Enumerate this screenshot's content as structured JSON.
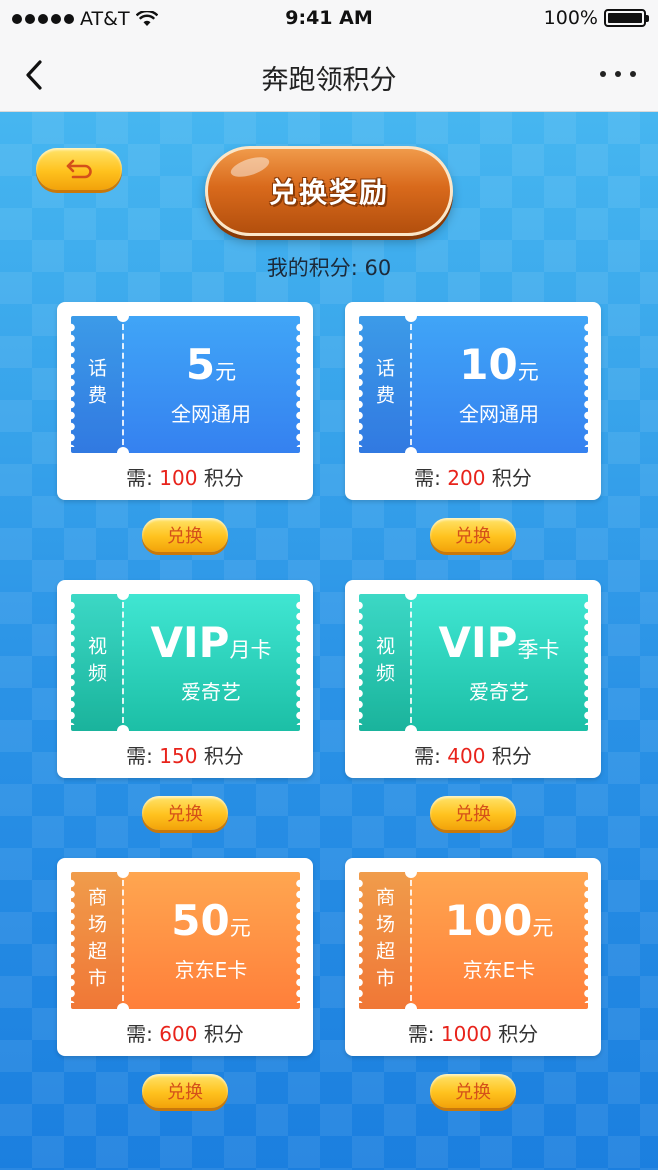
{
  "status_bar": {
    "carrier": "AT&T",
    "time": "9:41 AM",
    "battery": "100%"
  },
  "nav": {
    "title": "奔跑领积分"
  },
  "header": {
    "title_button": "兑换奖励",
    "points_label": "我的积分:",
    "points_value": "60"
  },
  "labels": {
    "need": "需:",
    "points_unit": "积分",
    "exchange": "兑换"
  },
  "cards": [
    {
      "category": "话费",
      "value": "5",
      "unit": "元",
      "desc": "全网通用",
      "cost": "100",
      "color": "blue"
    },
    {
      "category": "话费",
      "value": "10",
      "unit": "元",
      "desc": "全网通用",
      "cost": "200",
      "color": "blue"
    },
    {
      "category": "视频",
      "value": "VIP",
      "unit": "月卡",
      "desc": "爱奇艺",
      "cost": "150",
      "color": "green"
    },
    {
      "category": "视频",
      "value": "VIP",
      "unit": "季卡",
      "desc": "爱奇艺",
      "cost": "400",
      "color": "green"
    },
    {
      "category": "商场超市",
      "value": "50",
      "unit": "元",
      "desc": "京东E卡",
      "cost": "600",
      "color": "orange"
    },
    {
      "category": "商场超市",
      "value": "100",
      "unit": "元",
      "desc": "京东E卡",
      "cost": "1000",
      "color": "orange"
    }
  ]
}
